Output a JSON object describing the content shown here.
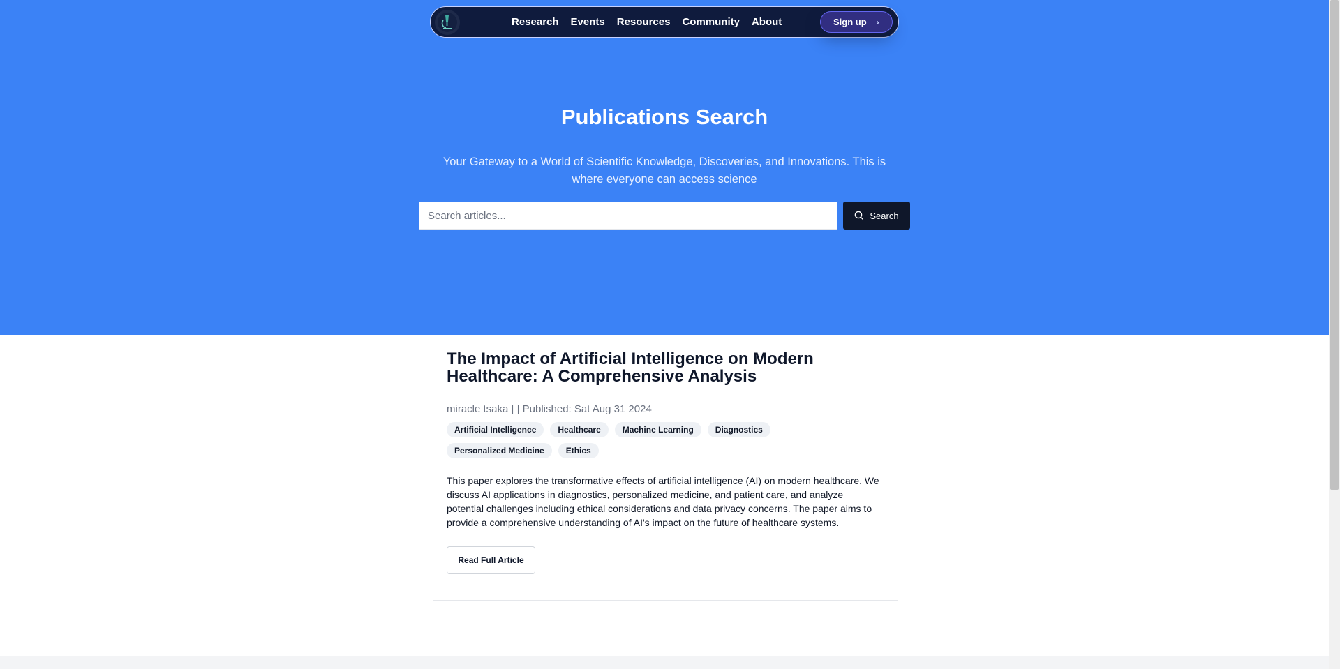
{
  "nav": {
    "logo_icon": "microscope-icon",
    "links": [
      "Research",
      "Events",
      "Resources",
      "Community",
      "About"
    ],
    "signup_label": "Sign up",
    "signup_icon": "chevron-right-icon"
  },
  "hero": {
    "title": "Publications Search",
    "subtitle": "Your Gateway to a World of Scientific Knowledge, Discoveries, and Innovations. This is where everyone can access science",
    "search_placeholder": "Search articles...",
    "search_button": "Search",
    "search_icon": "search-icon",
    "background_color": "#3b82f6"
  },
  "article": {
    "title": "The Impact of Artificial Intelligence on Modern Healthcare: A Comprehensive Analysis",
    "meta": "miracle tsaka | | Published: Sat Aug 31 2024",
    "tags": [
      "Artificial Intelligence",
      "Healthcare",
      "Machine Learning",
      "Diagnostics",
      "Personalized Medicine",
      "Ethics"
    ],
    "abstract": "This paper explores the transformative effects of artificial intelligence (AI) on modern healthcare. We discuss AI applications in diagnostics, personalized medicine, and patient care, and analyze potential challenges including ethical considerations and data privacy concerns. The paper aims to provide a comprehensive understanding of AI's impact on the future of healthcare systems.",
    "read_button": "Read Full Article"
  }
}
